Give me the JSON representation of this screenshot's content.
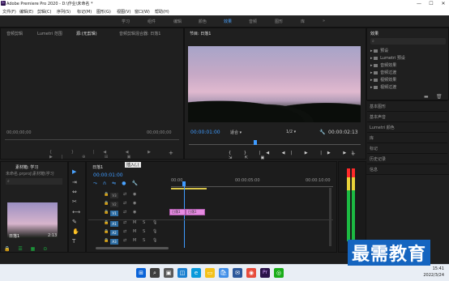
{
  "window": {
    "title": "Adobe Premiere Pro 2020 - D:\\作业\\未命名 *",
    "app_icon": "Pr",
    "controls": [
      "—",
      "☐",
      "✕"
    ]
  },
  "menu": [
    "文件(F)",
    "编辑(E)",
    "剪辑(C)",
    "序列(S)",
    "标记(M)",
    "图形(G)",
    "视图(V)",
    "窗口(W)",
    "帮助(H)"
  ],
  "workspaces": [
    "学习",
    "组件",
    "编辑",
    "颜色",
    "效果",
    "音频",
    "图形",
    "库"
  ],
  "workspaces_active": "效果",
  "source_panel": {
    "tabs": [
      "音频剪辑",
      "Lumetri 范围",
      "源:(无剪辑)",
      "音频剪辑混合器: 日落1"
    ],
    "timecode_left": "00;00;00;00",
    "timecode_right": "00;00;00;00"
  },
  "program_panel": {
    "title": "节目: 日落1",
    "timecode": "00:00:01:00",
    "fit": "适合",
    "resolution": "1/2",
    "duration": "00:00:02:13"
  },
  "effects_panel": {
    "title": "效果",
    "items": [
      "预设",
      "Lumetri 预设",
      "音频效果",
      "音频过渡",
      "视频效果",
      "视频过渡"
    ]
  },
  "right_sections": [
    "基本图形",
    "基本声音",
    "Lumetri 颜色",
    "库",
    "标记",
    "历史记录",
    "信息"
  ],
  "project_panel": {
    "title": "素材箱: 学习",
    "path": "未命名.prproj\\素材箱\\学习",
    "clip_name": "日落1",
    "clip_duration": "2:13"
  },
  "timeline": {
    "title": "日落1",
    "timecode": "00:00:01:00",
    "tooltip": "插入(,)",
    "ruler": [
      "00:00",
      "00:00:05:00",
      "00:00:10:00"
    ],
    "video_tracks": [
      "V3",
      "V2",
      "V1"
    ],
    "audio_tracks": [
      "A1",
      "A2",
      "A3"
    ],
    "clip_v": "日落1",
    "clip_a": "日落1",
    "selected_track": "V1"
  },
  "tools": [
    "select-tool",
    "track-select-tool",
    "ripple-edit-tool",
    "razor-tool",
    "slip-tool",
    "pen-tool",
    "hand-tool",
    "type-tool"
  ],
  "taskbar": {
    "time": "15:41",
    "date": "2022/3/24"
  },
  "watermark": "最需教育",
  "colors": {
    "accent_blue": "#3f9bff",
    "clip_pink": "#e58be1",
    "playhead": "#3f9bff",
    "audio_meter_green": "#1cba42",
    "audio_meter_red": "#ff2a2a"
  }
}
